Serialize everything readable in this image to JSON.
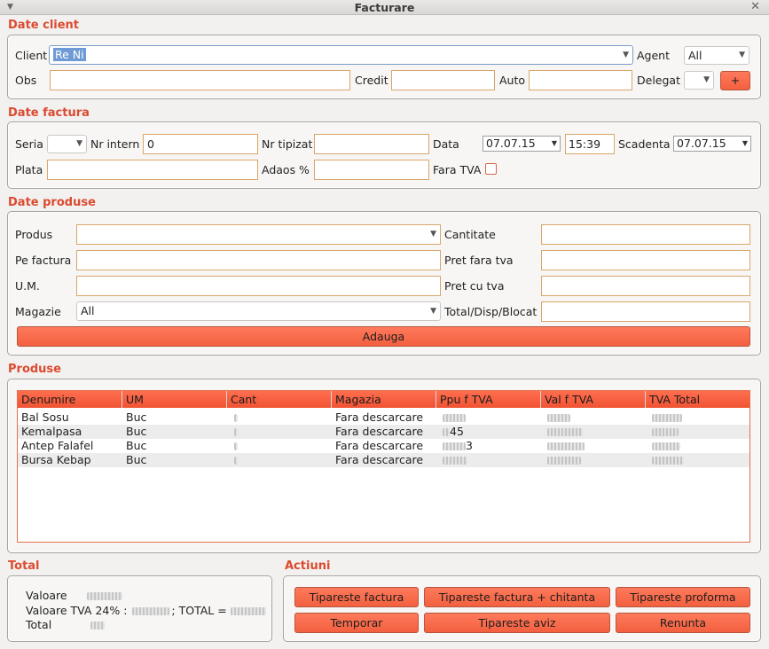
{
  "window": {
    "title": "Facturare"
  },
  "sections": {
    "client": "Date client",
    "factura": "Date factura",
    "produse_form": "Date produse",
    "produse_list": "Produse",
    "total": "Total",
    "actiuni": "Actiuni"
  },
  "client": {
    "client_label": "Client",
    "client_value": "Re Ni",
    "agent_label": "Agent",
    "agent_value": "All",
    "obs_label": "Obs",
    "credit_label": "Credit",
    "auto_label": "Auto",
    "delegat_label": "Delegat",
    "add_label": "+"
  },
  "factura": {
    "seria_label": "Seria",
    "nr_intern_label": "Nr intern",
    "nr_intern_value": "0",
    "nr_tipizat_label": "Nr tipizat",
    "data_label": "Data",
    "data_value": "07.07.15",
    "time_value": "15:39",
    "scadenta_label": "Scadenta",
    "scadenta_value": "07.07.15",
    "plata_label": "Plata",
    "adaos_label": "Adaos %",
    "fara_tva_label": "Fara TVA"
  },
  "produse_form": {
    "produs_label": "Produs",
    "cantitate_label": "Cantitate",
    "pe_factura_label": "Pe factura",
    "pret_fara_tva_label": "Pret fara tva",
    "um_label": "U.M.",
    "pret_cu_tva_label": "Pret cu tva",
    "magazie_label": "Magazie",
    "magazie_value": "All",
    "total_disp_label": "Total/Disp/Blocat",
    "adauga_label": "Adauga"
  },
  "table": {
    "columns": [
      "Denumire",
      "UM",
      "Cant",
      "Magazia",
      "Ppu f TVA",
      "Val f TVA",
      "TVA Total"
    ],
    "rows": [
      {
        "denumire": "Bal Sosu",
        "um": "Buc",
        "magazia": "Fara descarcare"
      },
      {
        "denumire": "Kemalpasa",
        "um": "Buc",
        "magazia": "Fara descarcare",
        "ppu": "45"
      },
      {
        "denumire": "Antep Falafel",
        "um": "Buc",
        "magazia": "Fara descarcare",
        "ppu": "3"
      },
      {
        "denumire": "Bursa Kebap",
        "um": "Buc",
        "magazia": "Fara descarcare"
      }
    ]
  },
  "total": {
    "valoare_label": "Valoare",
    "valoare_tva_label": "Valoare TVA 24% :",
    "total_sep": "; TOTAL =",
    "total_label": "Total"
  },
  "actions": {
    "tipareste_factura": "Tipareste factura",
    "tipareste_factura_chitanta": "Tipareste factura + chitanta",
    "tipareste_proforma": "Tipareste proforma",
    "temporar": "Temporar",
    "tipareste_aviz": "Tipareste aviz",
    "renunta": "Renunta"
  },
  "colors": {
    "accent": "#dc4a2f",
    "button": "#f2603f",
    "field_border": "#d8a66a"
  }
}
